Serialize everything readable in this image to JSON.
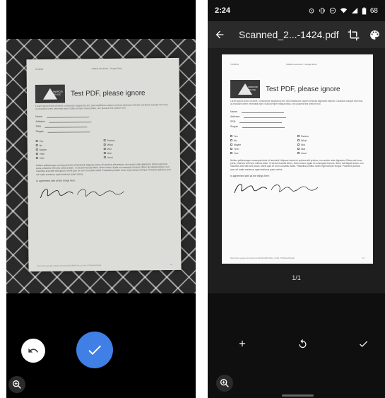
{
  "right": {
    "status": {
      "time": "2:24",
      "battery": "68"
    },
    "title": "Scanned_2...-1424.pdf",
    "page_counter": "1/1"
  },
  "document": {
    "header_left": "7/1/2019",
    "header_center": "Fillable document - Google Docs",
    "logo_text": "ANDROID POLICE",
    "title": "Test PDF, please ignore",
    "intro": "Lorem ipsum dolor sit amet, consectetur adipiscing elit. Sed vestibulum sapien vehicula dignissim blandit. Curabitur suscipit nisl risus, ac tincidunt lorem venenatis eget. Nulla semper massa tellus, nec placerat est pretium nec.",
    "fields": [
      "Name",
      "Address",
      "SSN",
      "Slogan"
    ],
    "checkboxes_left": [
      "Yes",
      "No",
      "Maybe",
      "Yes!!",
      "Yes!"
    ],
    "checkboxes_right": [
      "Pardon",
      "What",
      "Wut",
      "Wat",
      "Uwot"
    ],
    "paragraph": "Nullam pellentesque consequat dolor id hendrerit. Aliquam luctus mi pulvinar elit pretium, non auctor ante dignissim. Etiam sed nunc porta, pharetra velit sed, ultrices diam. In sit amet iaculis libero. Nam cursus, ligula et consequat rhoncus, libero dui aliquet lectus, non maximus erat nibh sed ipsum. Morbi quis ex id mi convallis mollis. Phasellus porttitor lorem eget semper tempor. Praesent pulvinar arcu vel turpis maximus, eget maximus quam varius.",
    "agree": "In agreement with all the things here:",
    "footer_left": "https://docs.google.com/document/d/1Wr2dM8r1Mw_m7wM_r5PIWZaxRQ/edit",
    "footer_right": "1/1"
  }
}
